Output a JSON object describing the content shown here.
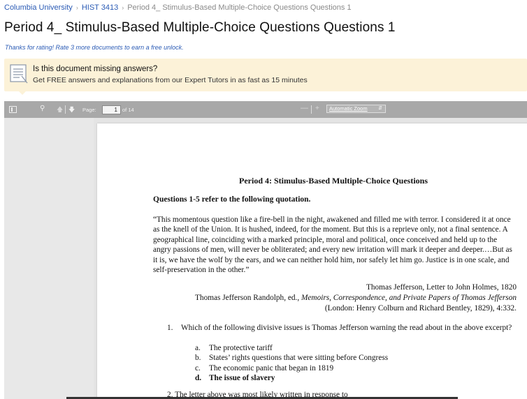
{
  "breadcrumb": {
    "school": "Columbia University",
    "course": "HIST 3413",
    "current": "Period 4_ Stimulus-Based Multiple-Choice Questions Questions 1",
    "separator": "›"
  },
  "page_title": "Period 4_ Stimulus-Based Multiple-Choice Questions Questions 1",
  "rating_note": "Thanks for rating! Rate 3 more documents to earn a free unlock.",
  "banner": {
    "question": "Is this document missing answers?",
    "subtext": "Get FREE answers and explanations from our Expert Tutors in as fast as 15 minutes",
    "icon": "document-lines-icon",
    "bg_color": "#fcf2d8"
  },
  "toolbar": {
    "page_label": "Page:",
    "current_page": "1",
    "page_count_label": "of 14",
    "zoom_label": "Automatic Zoom",
    "icons": {
      "sidebar": "sidebar-toggle-icon",
      "search": "search-icon",
      "prev": "arrow-up-icon",
      "next": "arrow-down-icon",
      "zoom_out": "minus-icon",
      "zoom_in": "plus-icon",
      "dropdown": "caret-icon"
    }
  },
  "document": {
    "heading": "Period 4: Stimulus-Based Multiple-Choice Questions",
    "refer": "Questions 1-5 refer to the following quotation.",
    "quote": "“This momentous question like a fire-bell in the night, awakened and filled me with terror. I considered it at once as the knell of the Union. It is hushed, indeed, for the moment. But this is a reprieve only, not a final sentence. A geographical line, coinciding with a marked principle, moral and political, once conceived and held up to the angry passions of men, will never be obliterated; and every new irritation will mark it deeper and deeper.…But as it is, we have the wolf by the ears, and we can neither hold him, nor safely let him go. Justice is in one scale, and self-preservation in the other.”",
    "attribution_line1": "Thomas Jefferson, Letter to John Holmes, 1820",
    "attribution_line2_prefix": "Thomas Jefferson Randolph, ed., ",
    "attribution_line2_title": "Memoirs, Correspondence, and Private Papers of Thomas Jefferson",
    "attribution_line3": "(London: Henry Colburn and Richard Bentley, 1829), 4:332.",
    "question1": {
      "number": "1.",
      "text": "Which of the following divisive issues is Thomas Jefferson warning the read about in the above excerpt?",
      "choices": [
        {
          "letter": "a.",
          "text": "The protective tariff"
        },
        {
          "letter": "b.",
          "text": "States’ rights questions that were sitting before Congress"
        },
        {
          "letter": "c.",
          "text": "The economic panic that began in 1819"
        },
        {
          "letter": "d.",
          "text": "The issue of slavery"
        }
      ]
    },
    "question2_partial": "2.   The letter above was most likely written in response to"
  }
}
